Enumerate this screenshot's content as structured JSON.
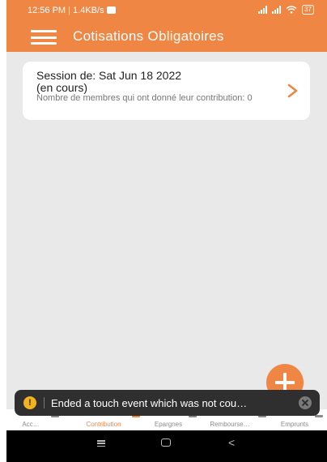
{
  "status_bar": {
    "time": "12:56 PM | 1.4KB/s",
    "battery": "37"
  },
  "app_bar": {
    "title": "Cotisations Obligatoires"
  },
  "session_card": {
    "line1": "Session de: Sat Jun 18 2022",
    "line2": "(en cours)",
    "line3": "Nombre de membres qui ont donné leur contribution: 0"
  },
  "bottom_nav": {
    "items": [
      {
        "label": "Acc…",
        "active": false
      },
      {
        "label": "Contribution",
        "active": true
      },
      {
        "label": "Epargnes",
        "active": false
      },
      {
        "label": "Rembourse…",
        "active": false
      },
      {
        "label": "Emprunts",
        "active": false
      }
    ]
  },
  "toast": {
    "icon": "warning-icon",
    "message": "Ended a touch event which was not cou…"
  },
  "colors": {
    "accent": "#f08644",
    "background": "#e9e9e9",
    "toast": "#2f2f2f"
  }
}
